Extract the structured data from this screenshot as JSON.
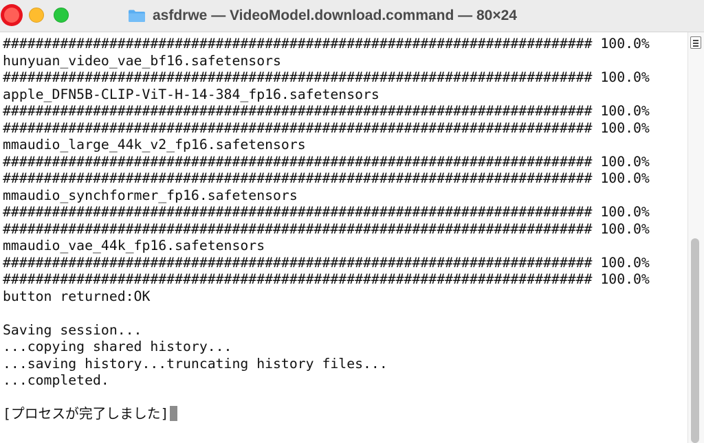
{
  "window": {
    "title": "asfdrwe — VideoModel.download.command — 80×24",
    "icon": "folder-icon"
  },
  "traffic_lights": {
    "close_color": "#ff5f57",
    "minimize_color": "#febc2e",
    "maximize_color": "#28c840"
  },
  "terminal": {
    "lines": [
      "######################################################################## 100.0%",
      "hunyuan_video_vae_bf16.safetensors",
      "######################################################################## 100.0%",
      "apple_DFN5B-CLIP-ViT-H-14-384_fp16.safetensors",
      "######################################################################## 100.0%",
      "######################################################################## 100.0%",
      "mmaudio_large_44k_v2_fp16.safetensors",
      "######################################################################## 100.0%",
      "######################################################################## 100.0%",
      "mmaudio_synchformer_fp16.safetensors",
      "######################################################################## 100.0%",
      "######################################################################## 100.0%",
      "mmaudio_vae_44k_fp16.safetensors",
      "######################################################################## 100.0%",
      "######################################################################## 100.0%",
      "button returned:OK",
      "",
      "Saving session...",
      "...copying shared history...",
      "...saving history...truncating history files...",
      "...completed.",
      "",
      "[プロセスが完了しました]"
    ]
  },
  "scrollbar": {
    "icon": "scroll-lines-icon",
    "thumb_color": "#c2c2c2"
  }
}
